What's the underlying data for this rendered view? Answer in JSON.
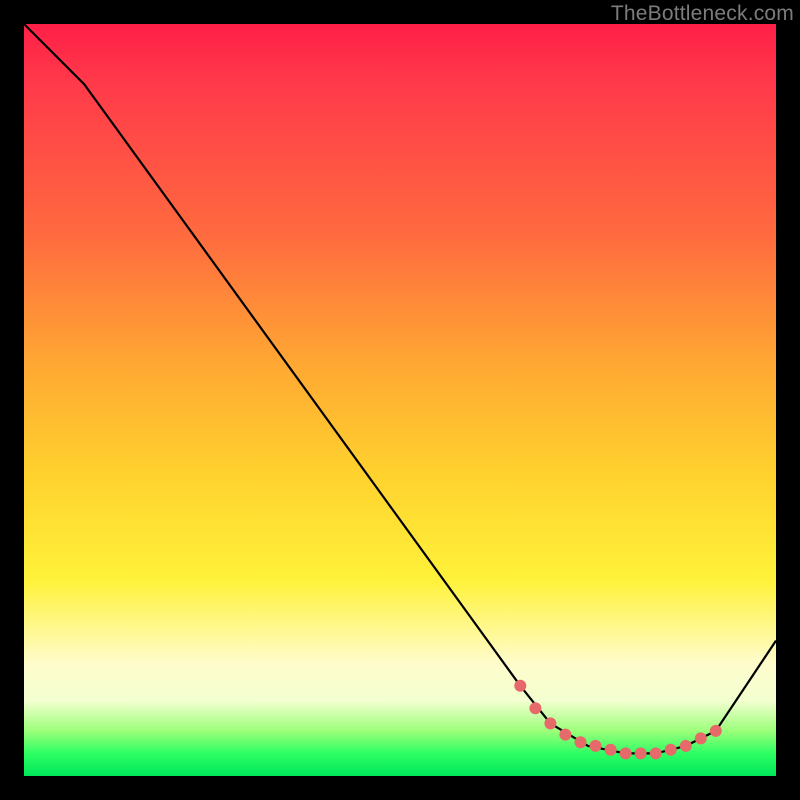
{
  "watermark": "TheBottleneck.com",
  "chart_data": {
    "type": "line",
    "title": "",
    "xlabel": "",
    "ylabel": "",
    "xlim": [
      0,
      100
    ],
    "ylim": [
      0,
      100
    ],
    "series": [
      {
        "name": "bottleneck-curve",
        "x": [
          0,
          8,
          66,
          70,
          75,
          80,
          84,
          88,
          92,
          100
        ],
        "y": [
          100,
          92,
          12,
          7,
          4,
          3,
          3,
          4,
          6,
          18
        ]
      }
    ],
    "markers": {
      "name": "valley-dots",
      "x": [
        66,
        68,
        70,
        72,
        74,
        76,
        78,
        80,
        82,
        84,
        86,
        88,
        90,
        92
      ],
      "y": [
        12,
        9,
        7,
        5.5,
        4.5,
        4,
        3.5,
        3,
        3,
        3,
        3.5,
        4,
        5,
        6
      ]
    },
    "colors": {
      "curve": "#000000",
      "dot": "#e66a6a",
      "grad_top": "#ff1f47",
      "grad_mid": "#fff23a",
      "grad_bot": "#00e65a"
    }
  }
}
